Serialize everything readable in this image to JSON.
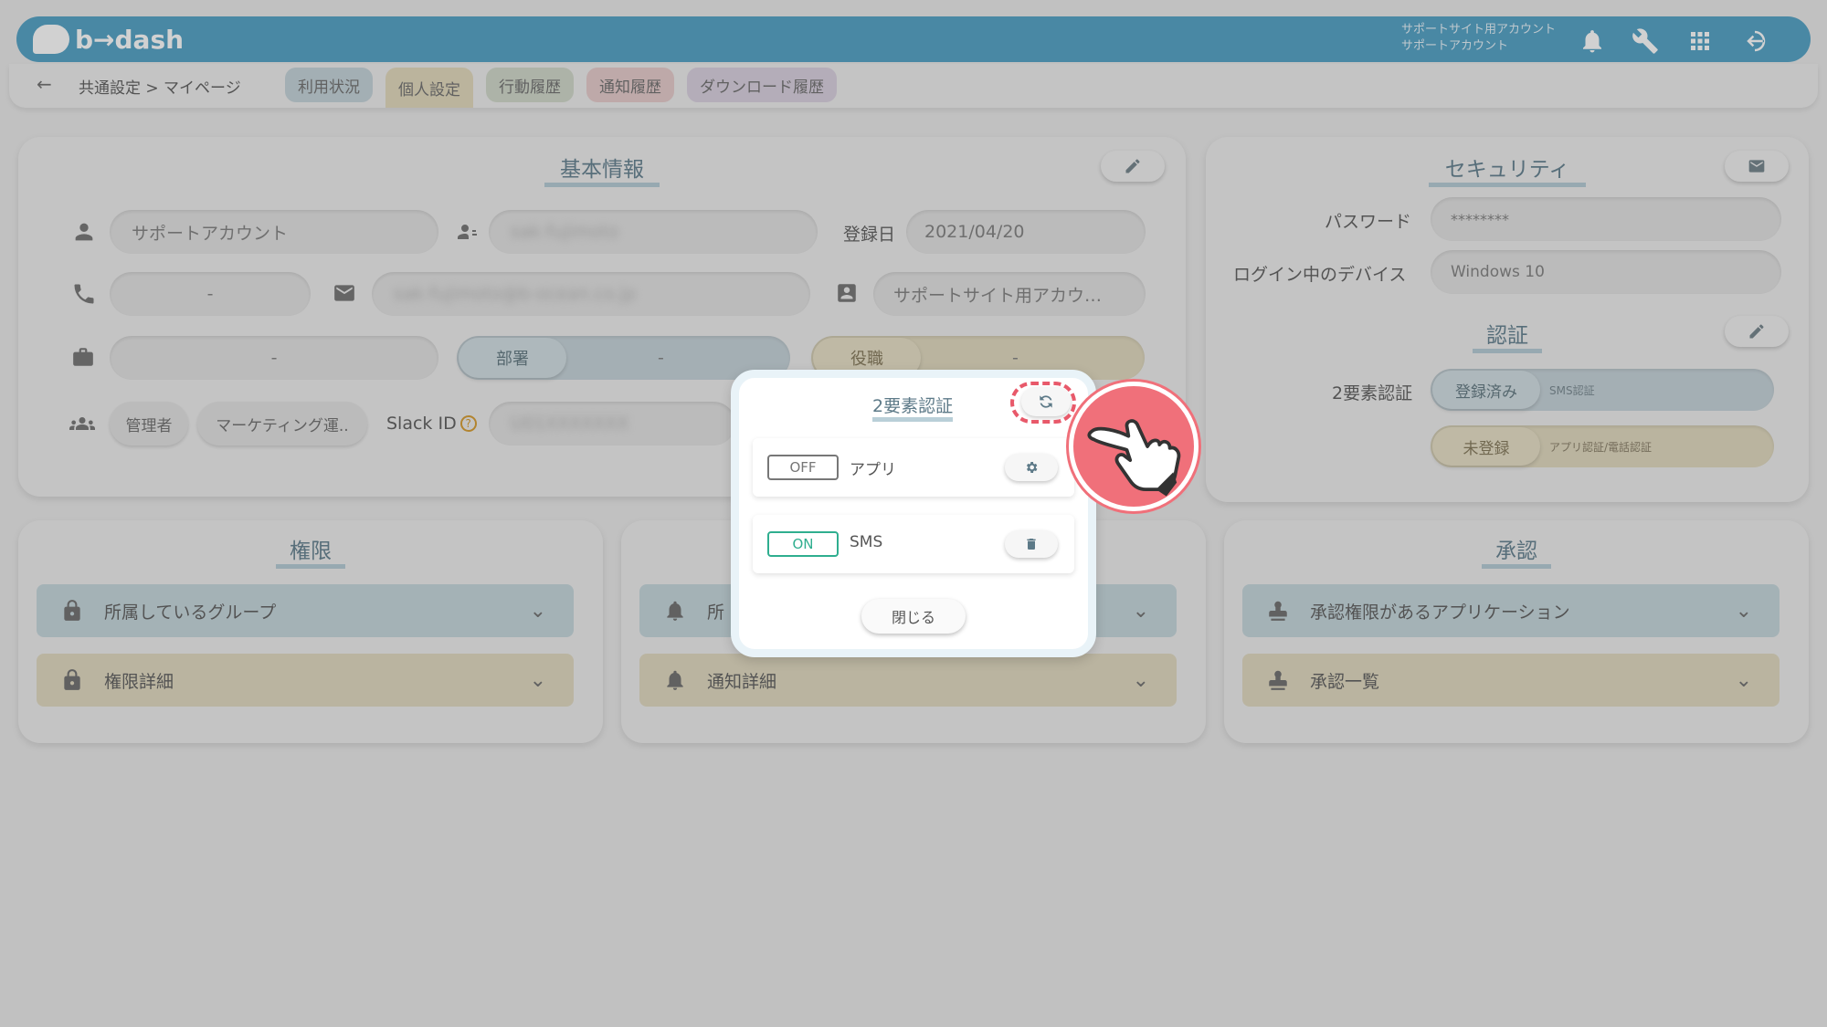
{
  "header": {
    "brand": "b→dash",
    "account_line1": "サポートサイト用アカウント",
    "account_line2": "サポートアカウント",
    "icons": [
      "bell-icon",
      "wrench-icon",
      "apps-grid-icon",
      "logout-icon"
    ]
  },
  "nav": {
    "back": "←",
    "breadcrumb": "共通設定 > マイページ",
    "tabs": [
      {
        "label": "利用状況",
        "color": "#c7d6dc"
      },
      {
        "label": "個人設定",
        "color": "#e5dcc0"
      },
      {
        "label": "行動履歴",
        "color": "#d3dbcd"
      },
      {
        "label": "通知履歴",
        "color": "#e8cfcf"
      },
      {
        "label": "ダウンロード履歴",
        "color": "#dcd3e2"
      }
    ]
  },
  "basic_info": {
    "title": "基本情報",
    "name": "サポートアカウント",
    "username": "sak-fujimoto",
    "registered_label": "登録日",
    "registered_date": "2021/04/20",
    "phone": "-",
    "email": "sak-fujimoto@b-ocean.co.jp",
    "account_type": "サポートサイト用アカウ…",
    "company": "-",
    "dept_label": "部署",
    "dept_value": "-",
    "role_label": "役職",
    "role_value": "-",
    "group1": "管理者",
    "group2": "マーケティング運..",
    "slack_label": "Slack ID",
    "slack_help": "?",
    "slack_value": "U01XXXXXXX"
  },
  "security": {
    "title": "セキュリティ",
    "password_label": "パスワード",
    "password_value": "********",
    "device_label": "ログイン中のデバイス",
    "device_value": "Windows 10",
    "auth_title": "認証",
    "twofa_label": "2要素認証",
    "registered_badge": "登録済み",
    "registered_method": "SMS認証",
    "unregistered_badge": "未登録",
    "unregistered_method": "アプリ認証/電話認証"
  },
  "permissions": {
    "title": "権限",
    "item1": "所属しているグループ",
    "item2": "権限詳細"
  },
  "notifications": {
    "item1": "所",
    "item2": "通知詳細"
  },
  "approval": {
    "title": "承認",
    "item1": "承認権限があるアプリケーション",
    "item2": "承認一覧"
  },
  "modal": {
    "title": "2要素認証",
    "rows": [
      {
        "toggle": "OFF",
        "label": "アプリ",
        "action_icon": "gear-icon"
      },
      {
        "toggle": "ON",
        "label": "SMS",
        "action_icon": "trash-icon"
      }
    ],
    "close": "閉じる"
  },
  "colors": {
    "header": "#5aa6c9",
    "toggle_on": "#2fae8f",
    "highlight": "#e8596a"
  }
}
